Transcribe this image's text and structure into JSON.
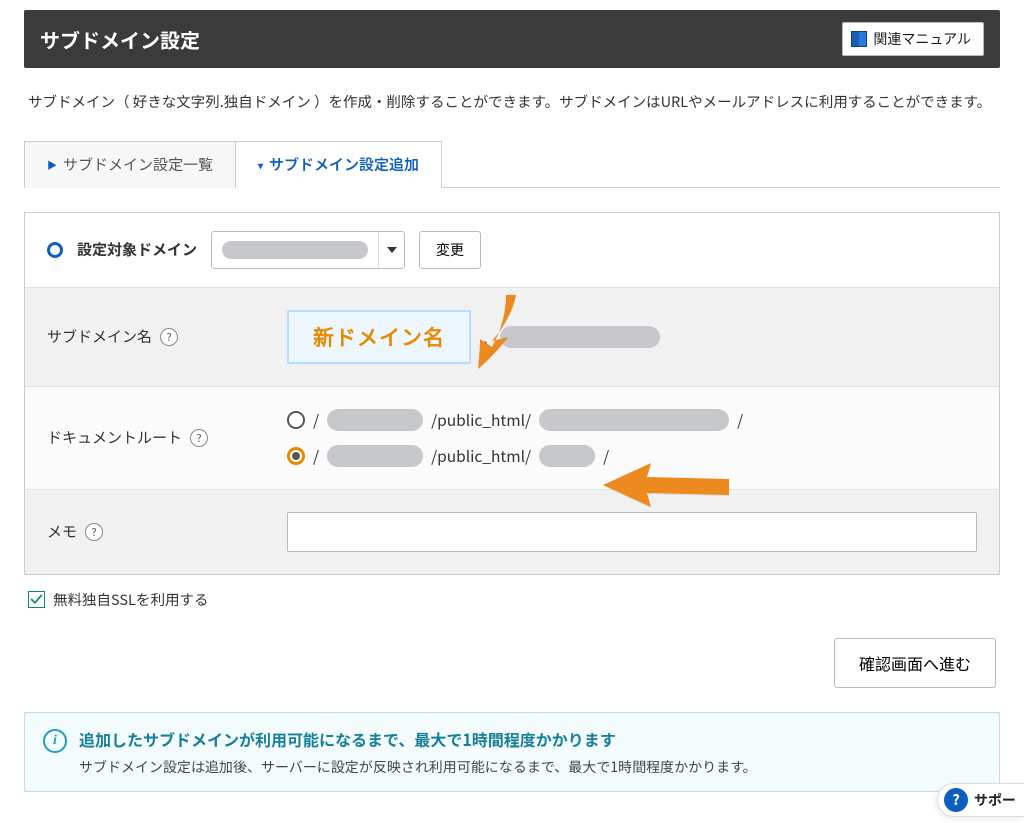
{
  "header": {
    "title": "サブドメイン設定",
    "manual_label": "関連マニュアル"
  },
  "intro": "サブドメイン（ 好きな文字列.独自ドメイン ）を作成・削除することができます。サブドメインはURLやメールアドレスに利用することができます。",
  "tabs": {
    "list_label": "サブドメイン設定一覧",
    "add_label": "サブドメイン設定追加"
  },
  "domain_row": {
    "label": "設定対象ドメイン",
    "change_label": "変更"
  },
  "form": {
    "subdomain": {
      "label": "サブドメイン名",
      "input_annotation": "新ドメイン名"
    },
    "docroot": {
      "label": "ドキュメントルート",
      "path_segment": "/public_html/",
      "slash": "/"
    },
    "memo": {
      "label": "メモ"
    }
  },
  "ssl": {
    "label": "無料独自SSLを利用する"
  },
  "confirm": {
    "label": "確認画面へ進む"
  },
  "info": {
    "title": "追加したサブドメインが利用可能になるまで、最大で1時間程度かかります",
    "body": "サブドメイン設定は追加後、サーバーに設定が反映され利用可能になるまで、最大で1時間程度かかります。"
  },
  "support": {
    "label": "サポー"
  }
}
